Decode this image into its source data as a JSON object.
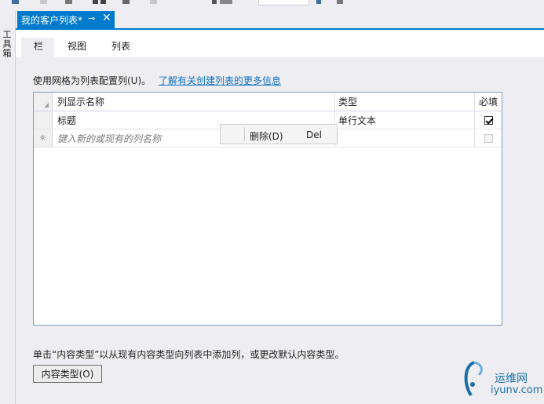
{
  "window": {
    "toolbox_label": "工具箱",
    "tab_title": "我的客户列表*",
    "pin_icon": "pin-icon",
    "close_icon": "close-icon"
  },
  "subtabs": [
    {
      "label": "栏",
      "active": true
    },
    {
      "label": "视图",
      "active": false
    },
    {
      "label": "列表",
      "active": false
    }
  ],
  "instruction": {
    "text": "使用网格为列表配置列(U)。",
    "link": "了解有关创建列表的更多信息"
  },
  "grid": {
    "headers": {
      "name": "列显示名称",
      "type": "类型",
      "required": "必填"
    },
    "rows": [
      {
        "name": "标题",
        "type": "单行文本",
        "required": true
      }
    ],
    "new_row_placeholder": "键入新的或现有的列名称"
  },
  "context_menu": {
    "item_label": "删除(D)",
    "item_shortcut": "Del"
  },
  "bottom": {
    "text": "单击“内容类型”以从现有内容类型向列表中添加列，或更改默认内容类型。",
    "button_label": "内容类型(O)"
  },
  "watermark": {
    "cn": "运维网",
    "en": "iyunv.com"
  },
  "colors": {
    "accent": "#007acc",
    "link": "#0e70c0"
  }
}
